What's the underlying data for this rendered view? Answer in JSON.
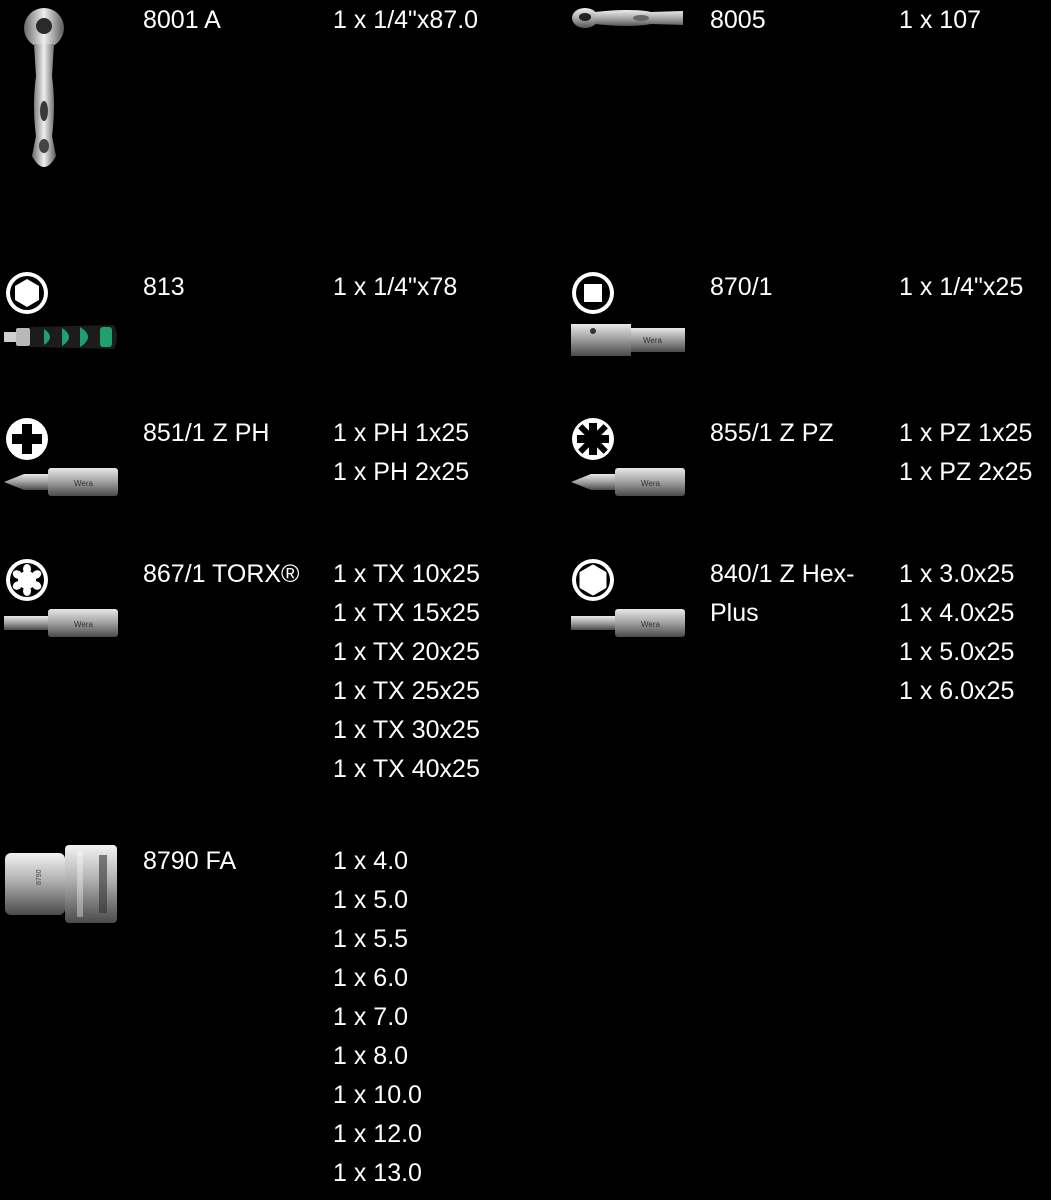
{
  "items": [
    {
      "code": "8001 A",
      "contents": [
        "1 x 1/4\"x87.0"
      ],
      "icon": "ratchet-image"
    },
    {
      "code": "8005",
      "contents": [
        "1 x 107"
      ],
      "icon": "ratchet-bit-holder-image"
    },
    {
      "code": "813",
      "contents": [
        "1 x 1/4\"x78"
      ],
      "icon": "screwdriver-bitholder-image",
      "profile_icon": "hexagon-socket-icon"
    },
    {
      "code": "870/1",
      "contents": [
        "1 x 1/4\"x25"
      ],
      "icon": "adaptor-image",
      "profile_icon": "square-drive-icon"
    },
    {
      "code": "851/1 Z PH",
      "contents": [
        "1 x PH 1x25",
        "1 x PH 2x25"
      ],
      "icon": "bit-image",
      "profile_icon": "phillips-icon"
    },
    {
      "code": "855/1 Z PZ",
      "contents": [
        "1 x PZ 1x25",
        "1 x PZ 2x25"
      ],
      "icon": "bit-image",
      "profile_icon": "pozidriv-icon"
    },
    {
      "code": "867/1 TORX®",
      "contents": [
        "1 x TX 10x25",
        "1 x TX 15x25",
        "1 x TX 20x25",
        "1 x TX 25x25",
        "1 x TX 30x25",
        "1 x TX 40x25"
      ],
      "icon": "bit-image",
      "profile_icon": "torx-icon"
    },
    {
      "code": "840/1 Z Hex-Plus",
      "code_lines": [
        "840/1 Z Hex-",
        "Plus"
      ],
      "contents": [
        "1 x 3.0x25",
        "1 x 4.0x25",
        "1 x 5.0x25",
        "1 x 6.0x25"
      ],
      "icon": "bit-image",
      "profile_icon": "hex-plus-icon"
    },
    {
      "code": "8790 FA",
      "contents": [
        "1 x 4.0",
        "1 x 5.0",
        "1 x 5.5",
        "1 x 6.0",
        "1 x 7.0",
        "1 x 8.0",
        "1 x 10.0",
        "1 x 12.0",
        "1 x 13.0"
      ],
      "icon": "socket-image"
    }
  ],
  "colors": {
    "background": "#000000",
    "text": "#ffffff",
    "metal": "#c8c8c8",
    "handle_green": "#1fa06e"
  }
}
